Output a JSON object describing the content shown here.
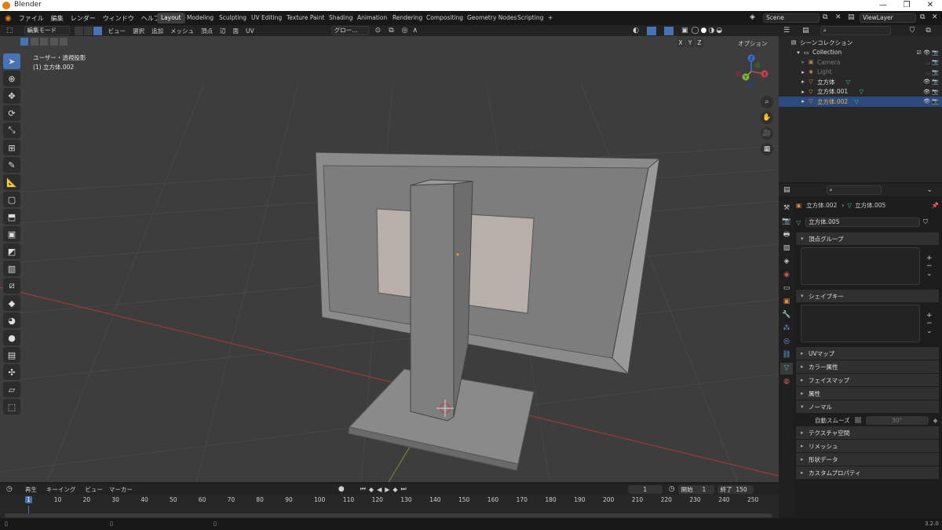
{
  "titlebar": {
    "app_title": "Blender",
    "min": "—",
    "max": "❐",
    "close": "✕"
  },
  "menu": {
    "items": [
      "ファイル",
      "編集",
      "レンダー",
      "ウィンドウ",
      "ヘルプ"
    ]
  },
  "workspaces": [
    "Layout",
    "Modeling",
    "Sculpting",
    "UV Editing",
    "Texture Paint",
    "Shading",
    "Animation",
    "Rendering",
    "Compositing",
    "Geometry Nodes",
    "Scripting"
  ],
  "add_workspace": "+",
  "scene": {
    "label": "Scene",
    "viewlayer": "ViewLayer"
  },
  "viewport_header": {
    "mode": "編集モード",
    "menus": [
      "ビュー",
      "選択",
      "追加",
      "メッシュ",
      "頂点",
      "辺",
      "面",
      "UV"
    ],
    "transform_orientation": "グロー…",
    "xyz": [
      "X",
      "Y",
      "Z"
    ],
    "options": "オプション"
  },
  "viewport_info": {
    "line1": "ユーザー・透視投影",
    "line2": "(1) 立方体.002"
  },
  "gizmo": {
    "x": "X",
    "y": "Y",
    "z": "Z"
  },
  "outliner": {
    "title": "シーンコレクション",
    "collection": "Collection",
    "items": [
      {
        "name": "Camera",
        "dim": true
      },
      {
        "name": "Light",
        "dim": true
      },
      {
        "name": "立方体",
        "dim": false
      },
      {
        "name": "立方体.001",
        "dim": false
      },
      {
        "name": "立方体.002",
        "dim": false,
        "selected": true
      }
    ]
  },
  "properties": {
    "breadcrumb_object": "立方体.002",
    "breadcrumb_mesh": "立方体.005",
    "mesh_name": "立方体.005",
    "panels": {
      "vertex_groups": "頂点グループ",
      "shape_keys": "シェイプキー",
      "uv_maps": "UVマップ",
      "color_attributes": "カラー属性",
      "face_maps": "フェイスマップ",
      "attributes": "属性",
      "normals": "ノーマル",
      "auto_smooth": "自動スムーズ",
      "auto_smooth_angle": "30°",
      "texture_space": "テクスチャ空間",
      "remesh": "リメッシュ",
      "geometry_data": "形状データ",
      "custom_props": "カスタムプロパティ"
    }
  },
  "timeline": {
    "menus": [
      "再生",
      "キーイング",
      "ビュー",
      "マーカー"
    ],
    "current_frame": "1",
    "start_label": "開始",
    "start": "1",
    "end_label": "終了",
    "end": "150",
    "ticks": [
      "1",
      "10",
      "20",
      "30",
      "40",
      "50",
      "60",
      "70",
      "80",
      "90",
      "100",
      "110",
      "120",
      "130",
      "140",
      "150",
      "160",
      "170",
      "180",
      "190",
      "200",
      "210",
      "220",
      "230",
      "240",
      "250"
    ]
  },
  "status": {
    "version": "3.2.0"
  },
  "colors": {
    "accent": "#4772b3",
    "selected_row": "#2b4a7e",
    "grid_x": "#9b3a3a",
    "grid_y": "#6b8a2a"
  }
}
